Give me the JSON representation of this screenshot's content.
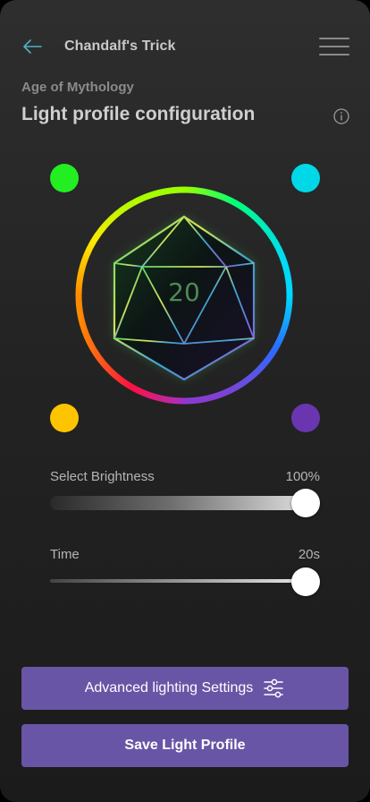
{
  "header": {
    "title": "Chandalf's Trick",
    "back_icon": "arrow-left-icon",
    "menu_icon": "hamburger-menu-icon"
  },
  "game": {
    "name": "Age of Mythology"
  },
  "page": {
    "title": "Light profile configuration",
    "info_icon": "info-icon"
  },
  "dice": {
    "face_value": "20"
  },
  "swatches": {
    "top_left": "#22ee22",
    "top_right": "#00d8e8",
    "bottom_left": "#ffc400",
    "bottom_right": "#6a35b0"
  },
  "brightness": {
    "label": "Select Brightness",
    "value": "100%",
    "level": 1.0
  },
  "time": {
    "label": "Time",
    "value": "20s",
    "level": 1.0
  },
  "buttons": {
    "advanced": "Advanced lighting Settings",
    "advanced_icon": "sliders-icon",
    "save": "Save Light Profile"
  },
  "colors": {
    "accent": "#6955a6",
    "background": "#232323"
  }
}
